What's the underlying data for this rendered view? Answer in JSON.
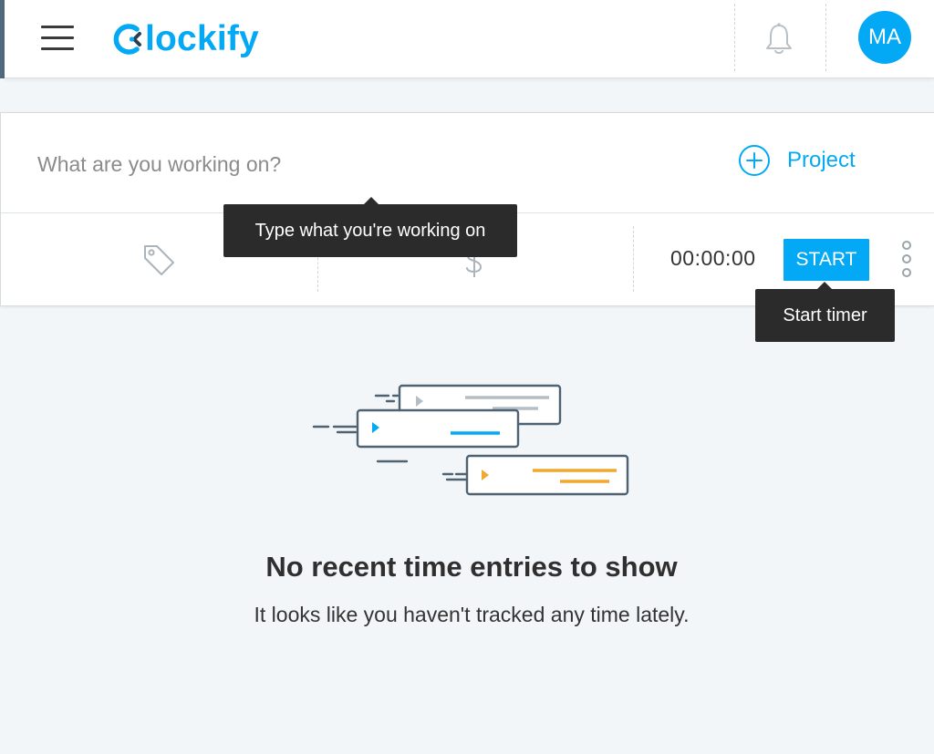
{
  "header": {
    "menu_icon": "hamburger-menu-icon",
    "logo_text": "lockify",
    "logo_mark_letter": "C",
    "notification_icon": "bell-icon",
    "avatar_initials": "MA",
    "brand_color": "#03a9f4"
  },
  "tracker": {
    "description_placeholder": "What are you working on?",
    "project_label": "Project",
    "project_icon": "plus-circle-icon",
    "tag_icon": "tag-icon",
    "billable_icon": "dollar-icon",
    "timer_value": "00:00:00",
    "start_label": "START",
    "more_icon": "vertical-dots-icon"
  },
  "tooltips": {
    "description": "Type what you're working on",
    "start": "Start timer"
  },
  "empty_state": {
    "title": "No recent time entries to show",
    "subtitle": "It looks like you haven't tracked any time lately.",
    "illustration_colors": [
      "#03a9f4",
      "#f0a830",
      "#b5bec4"
    ]
  }
}
